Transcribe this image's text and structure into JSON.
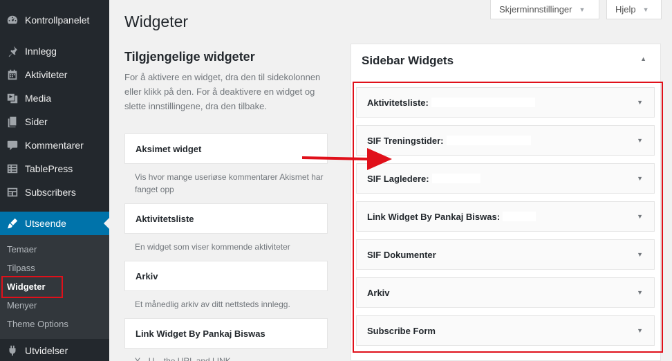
{
  "sidebar": {
    "items": [
      {
        "label": "Kontrollpanelet",
        "icon": "dashboard-icon"
      },
      {
        "label": "Innlegg",
        "icon": "pin-icon"
      },
      {
        "label": "Aktiviteter",
        "icon": "calendar-icon"
      },
      {
        "label": "Media",
        "icon": "media-icon"
      },
      {
        "label": "Sider",
        "icon": "pages-icon"
      },
      {
        "label": "Kommentarer",
        "icon": "comments-icon"
      },
      {
        "label": "TablePress",
        "icon": "table-icon"
      },
      {
        "label": "Subscribers",
        "icon": "subscribers-icon"
      },
      {
        "label": "Utseende",
        "icon": "appearance-icon"
      },
      {
        "label": "Utvidelser",
        "icon": "plugins-icon"
      }
    ],
    "submenu": [
      "Temaer",
      "Tilpass",
      "Widgeter",
      "Menyer",
      "Theme Options"
    ]
  },
  "topbar": {
    "screen_options": "Skjerminnstillinger",
    "help": "Hjelp"
  },
  "page": {
    "title": "Widgeter"
  },
  "available": {
    "title": "Tilgjengelige widgeter",
    "description": "For å aktivere en widget, dra den til sidekolonnen eller klikk på den. For å deaktivere en widget og slette innstillingene, dra den tilbake.",
    "widgets": [
      {
        "name": "Aksimet widget",
        "description": "Vis hvor mange useriøse kommentarer Akismet har fanget opp"
      },
      {
        "name": "Aktivitetsliste",
        "description": "En widget som viser kommende aktiviteter"
      },
      {
        "name": "Arkiv",
        "description": "Et månedlig arkiv av ditt nettsteds innlegg."
      },
      {
        "name": "Link Widget By Pankaj Biswas",
        "description": "Y...                    U...             the URL and LINK"
      }
    ]
  },
  "sidebar_widgets": {
    "title": "Sidebar Widgets",
    "widgets": [
      "Aktivitetsliste:",
      "SIF Treningstider:",
      "SIF Lagledere:",
      "Link Widget By Pankaj Biswas:",
      "SIF Dokumenter",
      "Arkiv",
      "Subscribe Form"
    ]
  },
  "colors": {
    "admin_bg": "#23282d",
    "active": "#0073aa",
    "highlight": "#e0101a"
  }
}
